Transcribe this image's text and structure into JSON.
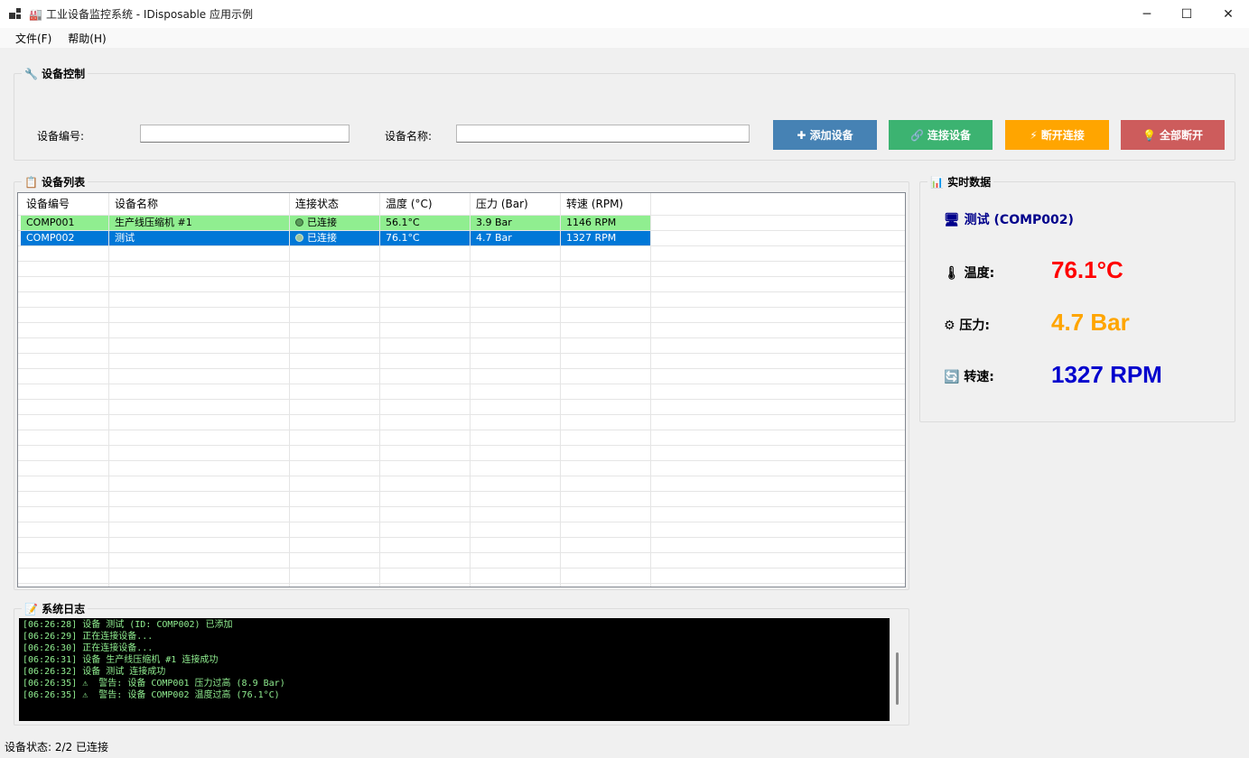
{
  "window": {
    "title_emoji": "🏭",
    "title": "工业设备监控系统 - IDisposable 应用示例",
    "minimize_glyph": "─",
    "maximize_glyph": "☐",
    "close_glyph": "✕"
  },
  "menu": [
    "文件(F)",
    "帮助(H)"
  ],
  "control_group": {
    "title": "🔧 设备控制",
    "device_id_label": "设备编号:",
    "device_id_value": "",
    "device_name_label": "设备名称:",
    "device_name_value": "",
    "buttons": {
      "add": "✚ 添加设备",
      "connect": "🔗 连接设备",
      "disconnect": "⚡ 断开连接",
      "disconnect_all": "💡 全部断开"
    },
    "colors": {
      "add": "#4682b4",
      "connect": "#3cb371",
      "disconnect": "#ffa500",
      "disconnect_all": "#cd5c5c"
    }
  },
  "list_group": {
    "title": "📋 设备列表",
    "columns": [
      "设备编号",
      "设备名称",
      "连接状态",
      "温度 (°C)",
      "压力 (Bar)",
      "转速 (RPM)"
    ],
    "rows": [
      [
        "COMP001",
        "生产线压缩机 #1",
        "已连接",
        "56.1°C",
        "3.9 Bar",
        "1146 RPM"
      ],
      [
        "COMP002",
        "测试",
        "已连接",
        "76.1°C",
        "4.7 Bar",
        "1327 RPM"
      ]
    ]
  },
  "realtime_group": {
    "title": "📊 实时数据",
    "device_title": "🖥 测试 (COMP002)",
    "temperature_label": "🌡 温度:",
    "temperature_value": "76.1°C",
    "pressure_label": "⚙ 压力:",
    "pressure_value": "4.7 Bar",
    "speed_label": "🔄 转速:",
    "speed_value": "1327 RPM",
    "colors": {
      "temperature": "#ff0000",
      "pressure": "#ffa500",
      "speed": "#0000cd"
    }
  },
  "log_group": {
    "title": "📝 系统日志",
    "lines": [
      "[06:26:28] 设备 测试 (ID: COMP002) 已添加",
      "[06:26:29] 正在连接设备...",
      "[06:26:30] 正在连接设备...",
      "[06:26:31] 设备 生产线压缩机 #1 连接成功",
      "[06:26:32] 设备 测试 连接成功",
      "[06:26:35] ⚠  警告: 设备 COMP001 压力过高 (8.9 Bar)",
      "[06:26:35] ⚠  警告: 设备 COMP002 温度过高 (76.1°C)"
    ]
  },
  "status_bar": "设备状态: 2/2 已连接"
}
